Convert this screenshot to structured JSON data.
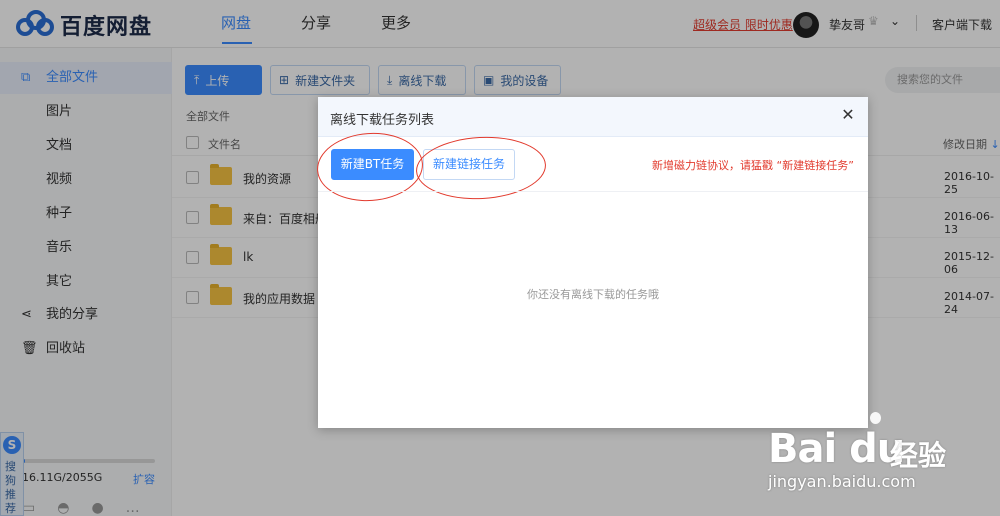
{
  "topbar": {
    "logo_text": "百度网盘",
    "nav": [
      "网盘",
      "分享",
      "更多"
    ],
    "promo": "超级会员 限时优惠",
    "username": "挚友哥",
    "client_download": "客户端下载"
  },
  "sidebar": {
    "items": [
      {
        "label": "全部文件",
        "icon": "copy-icon"
      },
      {
        "label": "图片"
      },
      {
        "label": "文档"
      },
      {
        "label": "视频"
      },
      {
        "label": "种子"
      },
      {
        "label": "音乐"
      },
      {
        "label": "其它"
      },
      {
        "label": "我的分享",
        "icon": "share-icon"
      },
      {
        "label": "回收站",
        "icon": "trash-icon"
      }
    ],
    "quota": "16.11G/2055G",
    "expand": "扩容",
    "quota_used_fraction": 0.0078
  },
  "toolbar": {
    "upload": "上传",
    "new_folder": "新建文件夹",
    "offline_download": "离线下载",
    "my_devices": "我的设备",
    "search_placeholder": "搜索您的文件"
  },
  "filelist": {
    "breadcrumb": "全部文件",
    "col_name": "文件名",
    "col_date": "修改日期",
    "rows": [
      {
        "name": "我的资源",
        "date": "2016-10-25"
      },
      {
        "name": "来自：百度相册",
        "date": "2016-06-13"
      },
      {
        "name": "lk",
        "date": "2015-12-06"
      },
      {
        "name": "我的应用数据",
        "date": "2014-07-24"
      }
    ]
  },
  "dialog": {
    "title": "离线下载任务列表",
    "new_bt": "新建BT任务",
    "new_link": "新建链接任务",
    "tip": "新增磁力链协议，请猛戳 “新建链接任务”",
    "empty": "你还没有离线下载的任务哦"
  },
  "sogou": {
    "label": "搜狗推荐"
  },
  "watermark": {
    "logo": "Bai du",
    "cn": "经验",
    "url": "jingyan.baidu.com"
  },
  "colors": {
    "accent": "#3b8cff",
    "promo_red": "#e23b2e",
    "annotation_ring": "#e23b2e"
  }
}
